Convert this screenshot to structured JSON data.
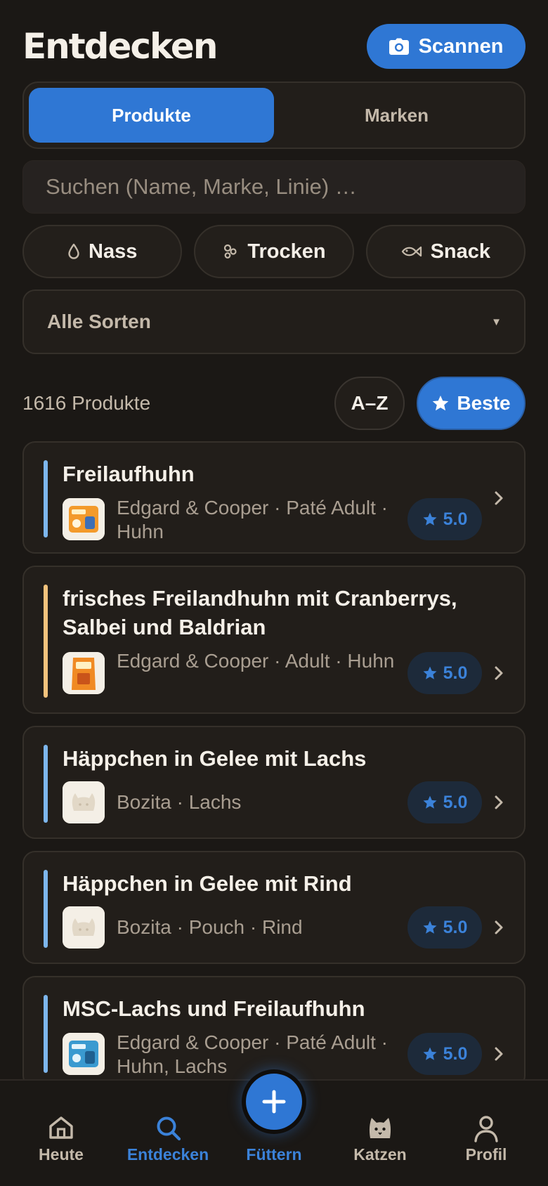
{
  "header": {
    "title": "Entdecken",
    "scan_label": "Scannen"
  },
  "segments": [
    {
      "label": "Produkte",
      "active": true
    },
    {
      "label": "Marken",
      "active": false
    }
  ],
  "search": {
    "placeholder": "Suchen (Name, Marke, Linie) …",
    "value": ""
  },
  "filters": [
    {
      "label": "Nass",
      "icon": "droplet-icon"
    },
    {
      "label": "Trocken",
      "icon": "kibble-icon"
    },
    {
      "label": "Snack",
      "icon": "fish-icon"
    }
  ],
  "sort_dropdown": {
    "selected": "Alle Sorten"
  },
  "results": {
    "count_label": "1616 Produkte",
    "sort_az_label": "A–Z",
    "sort_best_label": "Beste",
    "sort_best_active": true
  },
  "products": [
    {
      "title": "Freilaufhuhn",
      "subtitle": "Edgard & Cooper · Paté Adult · Huhn",
      "rating": "5.0",
      "accent": "#7db6ec",
      "thumb": "tray-orange"
    },
    {
      "title": "frisches Freilandhuhn mit Cranberrys, Salbei und Baldrian",
      "subtitle": "Edgard & Cooper · Adult · Huhn",
      "rating": "5.0",
      "accent": "#f2c27c",
      "thumb": "bag-orange"
    },
    {
      "title": "Häppchen in Gelee mit Lachs",
      "subtitle": "Bozita · Lachs",
      "rating": "5.0",
      "accent": "#7db6ec",
      "thumb": "cat-placeholder"
    },
    {
      "title": "Häppchen in Gelee mit Rind",
      "subtitle": "Bozita · Pouch · Rind",
      "rating": "5.0",
      "accent": "#7db6ec",
      "thumb": "cat-placeholder"
    },
    {
      "title": "MSC-Lachs und Freilaufhuhn",
      "subtitle": "Edgard & Cooper · Paté Adult · Huhn, Lachs",
      "rating": "5.0",
      "accent": "#7db6ec",
      "thumb": "tray-blue"
    }
  ],
  "tabbar": {
    "items": [
      {
        "label": "Heute",
        "icon": "home-icon",
        "active": false
      },
      {
        "label": "Entdecken",
        "icon": "search-icon",
        "active": true
      },
      {
        "label": "Füttern",
        "icon": "plus-icon",
        "active": false
      },
      {
        "label": "Katzen",
        "icon": "cat-icon",
        "active": false
      },
      {
        "label": "Profil",
        "icon": "profile-icon",
        "active": false
      }
    ]
  },
  "colors": {
    "background": "#1b1815",
    "accent": "#2f77d4",
    "card": "#221e1a"
  }
}
